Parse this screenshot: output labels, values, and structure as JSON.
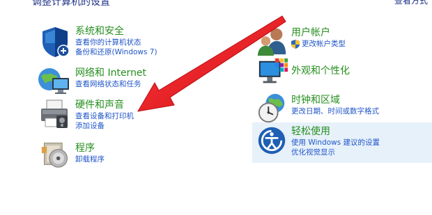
{
  "header": {
    "title": "调整计算机的设置",
    "view_by": "查看方式"
  },
  "left_categories": [
    {
      "title": "系统和安全",
      "icon": "shield-icon",
      "links": [
        "查看你的计算机状态",
        "备份和还原(Windows 7)"
      ]
    },
    {
      "title": "网络和 Internet",
      "icon": "network-globe-icon",
      "links": [
        "查看网络状态和任务"
      ]
    },
    {
      "title": "硬件和声音",
      "icon": "printer-icon",
      "links": [
        "查看设备和打印机",
        "添加设备"
      ]
    },
    {
      "title": "程序",
      "icon": "programs-disc-icon",
      "links": [
        "卸载程序"
      ]
    }
  ],
  "right_categories": [
    {
      "title": "用户帐户",
      "icon": "users-icon",
      "links": [
        "更改帐户类型"
      ]
    },
    {
      "title": "外观和个性化",
      "icon": "monitor-palette-icon",
      "links": []
    },
    {
      "title": "时钟和区域",
      "icon": "clock-globe-icon",
      "links": [
        "更改日期、时间或数字格式"
      ]
    },
    {
      "title": "轻松使用",
      "icon": "ease-of-access-icon",
      "links": [
        "使用 Windows 建议的设置",
        "优化视觉显示"
      ]
    }
  ],
  "colors": {
    "category_title": "#258f1e",
    "link": "#1f55c8",
    "annotation_arrow": "#e8141c",
    "hover_highlight": "#e7f1fa"
  }
}
